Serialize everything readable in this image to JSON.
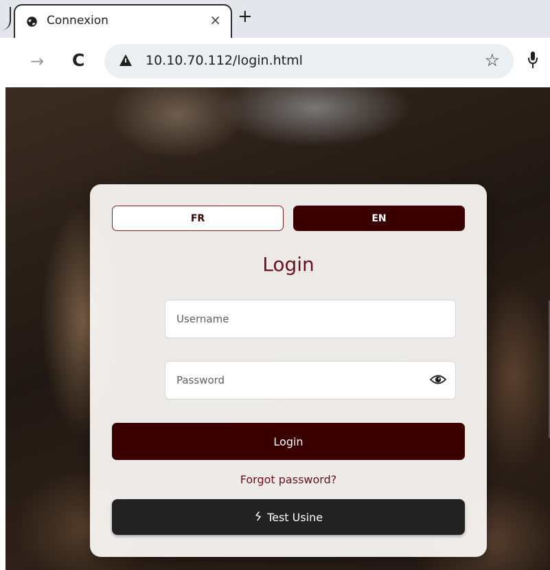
{
  "browser": {
    "tab": {
      "title": "Connexion",
      "favicon": "globe-icon",
      "close_glyph": "×"
    },
    "new_tab_glyph": "+",
    "toolbar": {
      "forward_glyph": "→",
      "reload_glyph": "C",
      "security_icon": "warning-icon",
      "url": "10.10.70.112/login.html",
      "bookmark_glyph": "☆",
      "mic_icon": "microphone-icon"
    }
  },
  "login_card": {
    "languages": {
      "fr": "FR",
      "en": "EN",
      "selected": "EN"
    },
    "title": "Login",
    "username": {
      "placeholder": "Username",
      "value": ""
    },
    "password": {
      "placeholder": "Password",
      "value": "",
      "toggle_icon": "eye-icon"
    },
    "login_button": "Login",
    "forgot_password": "Forgot password?",
    "test_button": {
      "icon": "wrench-icon",
      "label": "Test Usine"
    }
  },
  "colors": {
    "primary_dark": "#3a0000",
    "accent_text": "#6b0f1a",
    "test_button_bg": "#222222"
  }
}
